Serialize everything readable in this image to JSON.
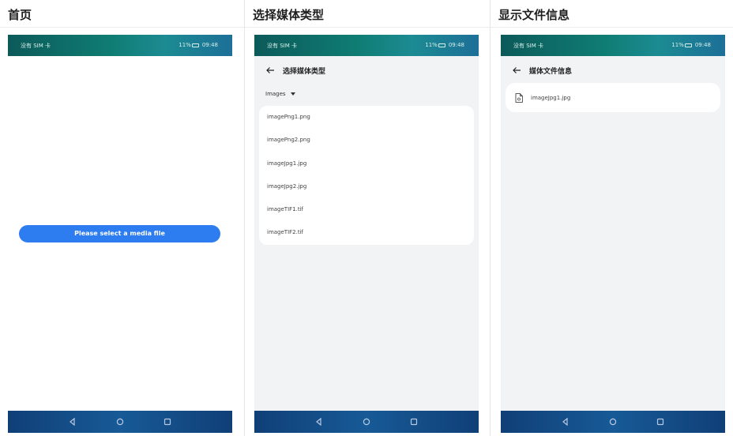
{
  "panels": [
    {
      "title": "首页"
    },
    {
      "title": "选择媒体类型"
    },
    {
      "title": "显示文件信息"
    }
  ],
  "status_bar": {
    "carrier": "没有 SIM 卡",
    "battery": "11%",
    "time": "09:48"
  },
  "home": {
    "select_button_label": "Please select a media file"
  },
  "select_type": {
    "page_title": "选择媒体类型",
    "dropdown_value": "Images",
    "files": [
      "imagePng1.png",
      "imagePng2.png",
      "imageJpg1.jpg",
      "imageJpg2.jpg",
      "imageTIF1.tif",
      "imageTIF2.tif"
    ]
  },
  "file_info": {
    "page_title": "媒体文件信息",
    "file_name": "imageJpg1.jpg"
  },
  "colors": {
    "accent": "#2d7cf0",
    "status_bar": "#0f7c72",
    "nav_bar": "#175a96",
    "surface": "#f1f3f5"
  },
  "icons": {
    "back": "arrow-left-icon",
    "file": "document-icon",
    "dropdown": "caret-down-icon",
    "nav_back": "triangle-back-icon",
    "nav_home": "circle-home-icon",
    "nav_recent": "square-recent-icon"
  }
}
